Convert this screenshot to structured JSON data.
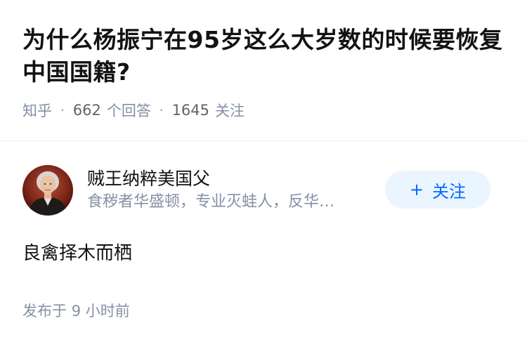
{
  "question": {
    "title": "为什么杨振宁在95岁这么大岁数的时候要恢复中国国籍?",
    "source": "知乎",
    "answer_count": "662",
    "answer_label": "个回答",
    "follower_count": "1645",
    "follower_label": "关注",
    "separator": "·"
  },
  "answer": {
    "author": {
      "name": "贼王纳粹美国父",
      "bio": "食秽者华盛顿，专业灭蛙人，反华…",
      "avatar_icon": "portrait-avatar"
    },
    "follow_button": {
      "plus": "+",
      "label": "关注"
    },
    "content": "良禽择木而栖",
    "published": "发布于",
    "published_time": "9 小时前"
  },
  "colors": {
    "title": "#121212",
    "meta": "#8590a6",
    "accent": "#0066ff",
    "button_bg": "#ebf5ff",
    "divider": "#f0f2f7"
  }
}
